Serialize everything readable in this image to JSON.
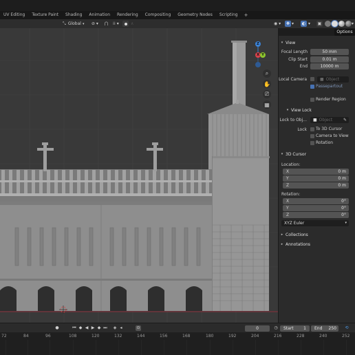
{
  "workspace_tabs": [
    "UV Editing",
    "Texture Paint",
    "Shading",
    "Animation",
    "Rendering",
    "Compositing",
    "Geometry Nodes",
    "Scripting"
  ],
  "add_workspace": "+",
  "header": {
    "orientation_label": "Global",
    "options_label": "Options"
  },
  "n_panel": {
    "view": {
      "title": "View",
      "focal_length_label": "Focal Length",
      "focal_length_value": "50 mm",
      "clip_start_label": "Clip Start",
      "clip_start_value": "0.01 m",
      "end_label": "End",
      "end_value": "10000 m",
      "local_camera_label": "Local Camera",
      "local_camera_value": "Object",
      "passepartout_label": "Passepartout",
      "render_region_label": "Render Region"
    },
    "view_lock": {
      "title": "View Lock",
      "lock_to_obj_label": "Lock to Obj...",
      "lock_to_obj_placeholder": "Object",
      "lock_label": "Lock",
      "to_3d_cursor_label": "To 3D Cursor",
      "camera_to_view_label": "Camera to View",
      "rotation_label": "Rotation"
    },
    "cursor_3d": {
      "title": "3D Cursor",
      "location_label": "Location:",
      "location": [
        {
          "axis": "X",
          "value": "0 m"
        },
        {
          "axis": "Y",
          "value": "0 m"
        },
        {
          "axis": "Z",
          "value": "0 m"
        }
      ],
      "rotation_label": "Rotation:",
      "rotation": [
        {
          "axis": "X",
          "value": "0°"
        },
        {
          "axis": "Y",
          "value": "0°"
        },
        {
          "axis": "Z",
          "value": "0°"
        }
      ],
      "rotation_mode": "XYZ Euler"
    },
    "collections_title": "Collections",
    "annotations_title": "Annotations"
  },
  "gizmo": {
    "z": "Z",
    "y": "Y",
    "x": "X",
    "colors": {
      "x": "#d6424b",
      "y": "#8cc42e",
      "z": "#3b82d6"
    }
  },
  "timeline": {
    "current_frame": "0",
    "start_label": "Start",
    "start_value": "1",
    "end_label": "End",
    "end_value": "250"
  },
  "ruler_ticks": [
    "72",
    "84",
    "96",
    "108",
    "120",
    "132",
    "144",
    "156",
    "168",
    "180",
    "192",
    "204",
    "216",
    "228",
    "240",
    "252"
  ],
  "colors": {
    "accent": "#4772b3",
    "viewport_bg": "#393939",
    "panel_bg": "#2b2b2b"
  }
}
